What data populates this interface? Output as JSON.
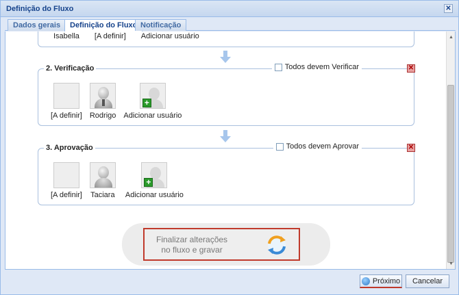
{
  "window": {
    "title": "Definição do Fluxo",
    "close_glyph": "✕"
  },
  "tabs": [
    {
      "label": "Dados gerais"
    },
    {
      "label": "Definição do Fluxo"
    },
    {
      "label": "Notificação"
    }
  ],
  "step1_partial": {
    "users": [
      "Isabella",
      "[A definir]",
      "Adicionar usuário"
    ]
  },
  "steps": [
    {
      "title": "2. Verificação",
      "checkbox_label": "Todos devem Verificar",
      "users": [
        {
          "name": "[A definir]",
          "type": "empty"
        },
        {
          "name": "Rodrigo",
          "type": "person-tie"
        },
        {
          "name": "Adicionar usuário",
          "type": "add"
        }
      ]
    },
    {
      "title": "3. Aprovação",
      "checkbox_label": "Todos devem Aprovar",
      "users": [
        {
          "name": "[A definir]",
          "type": "empty"
        },
        {
          "name": "Taciara",
          "type": "person"
        },
        {
          "name": "Adicionar usuário",
          "type": "add"
        }
      ]
    }
  ],
  "finalize": {
    "line1": "Finalizar alterações",
    "line2": "no fluxo e gravar"
  },
  "footer": {
    "next_label": "Próximo",
    "cancel_label": "Cancelar"
  },
  "colors": {
    "accent": "#15428b",
    "highlight": "#c0392b",
    "border": "#99bbe8"
  }
}
